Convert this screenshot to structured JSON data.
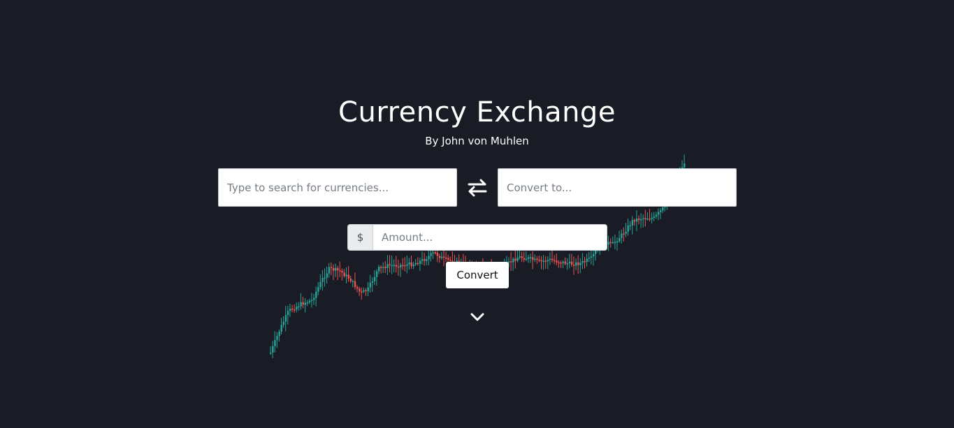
{
  "header": {
    "title": "Currency Exchange",
    "subtitle": "By John von Muhlen"
  },
  "converter": {
    "from_placeholder": "Type to search for currencies...",
    "to_placeholder": "Convert to...",
    "swap_icon": "swap-arrows-icon",
    "currency_symbol": "$",
    "amount_placeholder": "Amount...",
    "convert_label": "Convert",
    "scroll_icon": "chevron-down-icon"
  },
  "colors": {
    "background": "#191c25",
    "candle_up": "#26a69a",
    "candle_down": "#ef5350"
  }
}
